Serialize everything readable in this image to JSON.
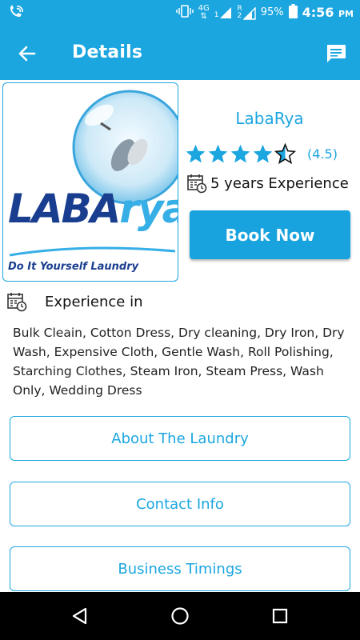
{
  "status_bar": {
    "network_label": "4G",
    "sim1_label": "1",
    "roaming_label": "R",
    "sim2_label": "2",
    "battery": "95%",
    "time": "4:56",
    "ampm": "PM"
  },
  "appbar": {
    "title": "Details",
    "back_icon": "arrow-left-icon",
    "chat_icon": "chat-icon"
  },
  "logo": {
    "brand_part1": "LABA",
    "brand_part2": "rya",
    "tagline": "Do It Yourself Laundry"
  },
  "profile": {
    "name": "LabaRya",
    "rating": 4.5,
    "rating_label": "(4.5)",
    "experience": "5 years Experience"
  },
  "book_button": {
    "label": "Book Now"
  },
  "experience_in": {
    "title": "Experience in",
    "services": "Bulk Cleain, Cotton Dress, Dry cleaning, Dry Iron, Dry Wash, Expensive Cloth, Gentle Wash, Roll Polishing, Starching Clothes, Steam Iron, Steam Press, Wash Only, Wedding Dress"
  },
  "buttons": {
    "about": "About The Laundry",
    "contact": "Contact Info",
    "timings": "Business Timings"
  },
  "colors": {
    "primary": "#1ba6e0",
    "star": "#1ba6e0",
    "brand_dark": "#1a3e8f"
  }
}
